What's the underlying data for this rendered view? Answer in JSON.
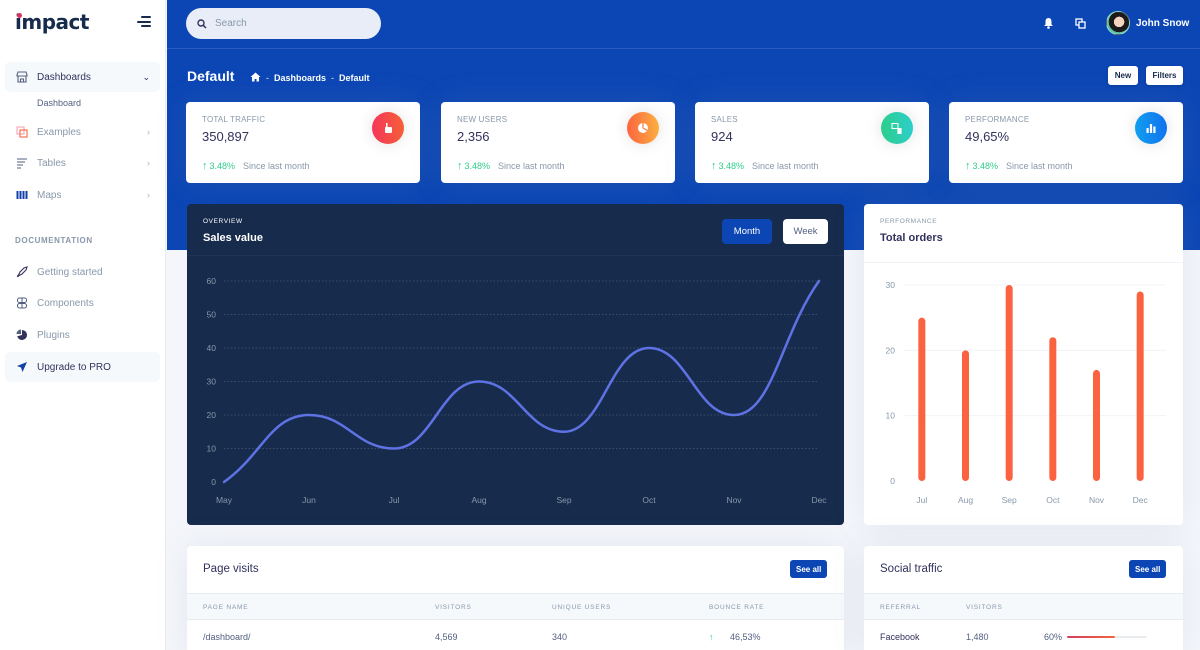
{
  "brand": {
    "name": "impact"
  },
  "sidebar": {
    "items": [
      {
        "label": "Dashboards",
        "icon": "shop-icon"
      },
      {
        "label": "Examples",
        "icon": "copy-icon"
      },
      {
        "label": "Tables",
        "icon": "list-icon"
      },
      {
        "label": "Maps",
        "icon": "map-icon"
      }
    ],
    "sub_items": [
      "Dashboard"
    ],
    "doc_heading": "DOCUMENTATION",
    "doc_items": [
      {
        "label": "Getting started",
        "icon": "rocket-icon"
      },
      {
        "label": "Components",
        "icon": "components-icon"
      },
      {
        "label": "Plugins",
        "icon": "pie-icon"
      },
      {
        "label": "Upgrade to PRO",
        "icon": "send-icon"
      }
    ]
  },
  "topbar": {
    "search_placeholder": "Search",
    "user_name": "John Snow"
  },
  "header": {
    "title": "Default",
    "breadcrumb": [
      "Dashboards",
      "Default"
    ],
    "new_label": "New",
    "filters_label": "Filters"
  },
  "stats": [
    {
      "label": "TOTAL TRAFFIC",
      "value": "350,897",
      "change": "3.48%",
      "since": "Since last month",
      "color": "#f5365c",
      "icon": "hand-pointer-icon"
    },
    {
      "label": "NEW USERS",
      "value": "2,356",
      "change": "3.48%",
      "since": "Since last month",
      "color": "#fb6340",
      "icon": "pie-chart-icon"
    },
    {
      "label": "SALES",
      "value": "924",
      "change": "3.48%",
      "since": "Since last month",
      "color": "#2dce89",
      "icon": "money-icon"
    },
    {
      "label": "PERFORMANCE",
      "value": "49,65%",
      "change": "3.48%",
      "since": "Since last month",
      "color": "#11a0ef",
      "icon": "bar-chart-icon"
    }
  ],
  "sales_card": {
    "overline": "OVERVIEW",
    "title": "Sales value",
    "month_label": "Month",
    "week_label": "Week"
  },
  "orders_card": {
    "overline": "PERFORMANCE",
    "title": "Total orders"
  },
  "page_visits": {
    "title": "Page visits",
    "see_all": "See all",
    "columns": [
      "PAGE NAME",
      "VISITORS",
      "UNIQUE USERS",
      "BOUNCE RATE"
    ],
    "rows": [
      {
        "page": "/dashboard/",
        "visitors": "4,569",
        "unique": "340",
        "bounce": "46,53%"
      }
    ]
  },
  "social_traffic": {
    "title": "Social traffic",
    "see_all": "See all",
    "columns": [
      "REFERRAL",
      "VISITORS"
    ],
    "rows": [
      {
        "referral": "Facebook",
        "visitors": "1,480",
        "percent_label": "60%",
        "percent": 60
      }
    ]
  },
  "chart_data": [
    {
      "type": "line",
      "title": "Sales value",
      "categories": [
        "May",
        "Jun",
        "Jul",
        "Aug",
        "Sep",
        "Oct",
        "Nov",
        "Dec"
      ],
      "values": [
        0,
        20,
        10,
        30,
        15,
        40,
        20,
        60
      ],
      "yticks": [
        0,
        10,
        20,
        30,
        40,
        50,
        60
      ],
      "ylim": [
        0,
        60
      ],
      "grid": true,
      "color": "#5e72e4"
    },
    {
      "type": "bar",
      "title": "Total orders",
      "categories": [
        "Jul",
        "Aug",
        "Sep",
        "Oct",
        "Nov",
        "Dec"
      ],
      "values": [
        25,
        20,
        30,
        22,
        17,
        29
      ],
      "yticks": [
        0,
        10,
        20,
        30
      ],
      "ylim": [
        0,
        30
      ],
      "grid": true,
      "color": "#fb6340"
    }
  ]
}
